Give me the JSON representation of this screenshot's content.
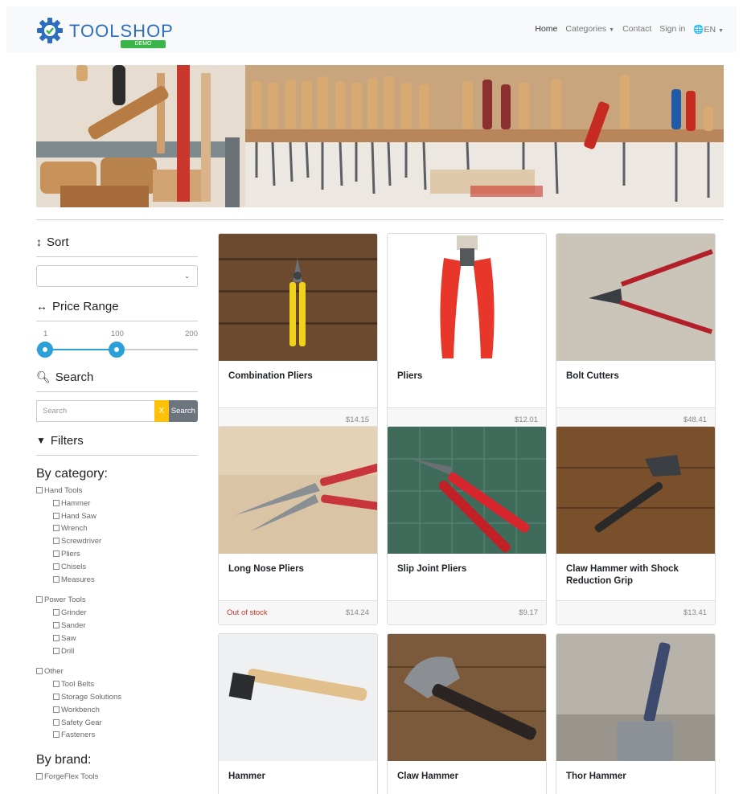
{
  "brand": {
    "name": "TOOLSHOP",
    "badge": "DEMO"
  },
  "nav": {
    "home": "Home",
    "categories": "Categories",
    "contact": "Contact",
    "signin": "Sign in",
    "language": "EN"
  },
  "sidebar": {
    "sort_title": "Sort",
    "sort_selected": "",
    "price_title": "Price Range",
    "price_min_label": "1",
    "price_value_label": "100",
    "price_max_label": "200",
    "search_title": "Search",
    "search_placeholder": "Search",
    "search_value": "",
    "clear_label": "X",
    "search_button": "Search",
    "filters_title": "Filters",
    "by_category_title": "By category:",
    "by_brand_title": "By brand:",
    "categories": [
      {
        "label": "Hand Tools",
        "children": [
          "Hammer",
          "Hand Saw",
          "Wrench",
          "Screwdriver",
          "Pliers",
          "Chisels",
          "Measures"
        ]
      },
      {
        "label": "Power Tools",
        "children": [
          "Grinder",
          "Sander",
          "Saw",
          "Drill"
        ]
      },
      {
        "label": "Other",
        "children": [
          "Tool Belts",
          "Storage Solutions",
          "Workbench",
          "Safety Gear",
          "Fasteners"
        ]
      }
    ],
    "brands": [
      "ForgeFlex Tools"
    ]
  },
  "products": [
    {
      "name": "Combination Pliers",
      "price": "$14.15",
      "stock": ""
    },
    {
      "name": "Pliers",
      "price": "$12.01",
      "stock": ""
    },
    {
      "name": "Bolt Cutters",
      "price": "$48.41",
      "stock": ""
    },
    {
      "name": "Long Nose Pliers",
      "price": "$14.24",
      "stock": "Out of stock"
    },
    {
      "name": "Slip Joint Pliers",
      "price": "$9.17",
      "stock": ""
    },
    {
      "name": "Claw Hammer with Shock Reduction Grip",
      "price": "$13.41",
      "stock": ""
    },
    {
      "name": "Hammer",
      "price": "",
      "stock": ""
    },
    {
      "name": "Claw Hammer",
      "price": "",
      "stock": ""
    },
    {
      "name": "Thor Hammer",
      "price": "",
      "stock": ""
    }
  ],
  "colors": {
    "accent": "#2ba0d8",
    "brand_blue": "#2d6dbf",
    "badge_green": "#3bb54a",
    "clear_yellow": "#ffc107",
    "button_gray": "#6c757d",
    "out_of_stock": "#c0392b"
  }
}
